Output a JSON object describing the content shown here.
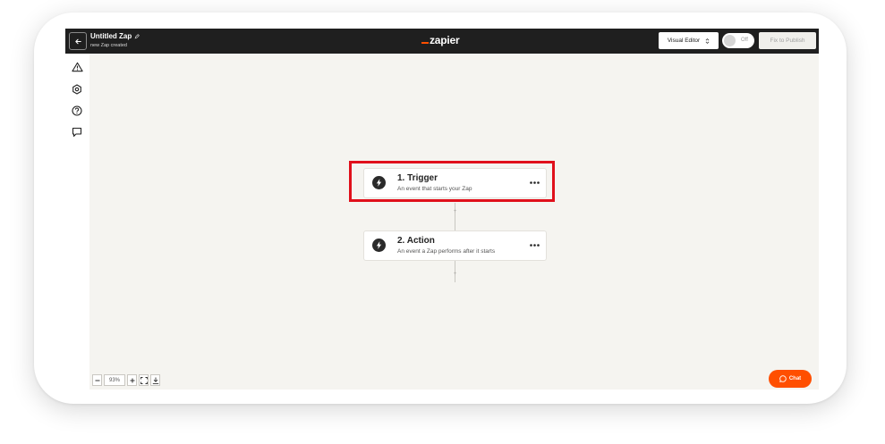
{
  "header": {
    "zap_title": "Untitled Zap",
    "zap_subtitle": "new Zap created",
    "logo_text": "zapier",
    "editor_select": "Visual Editor",
    "toggle_label": "Off",
    "publish_button": "Fix to Publish"
  },
  "sidebar": {
    "items": [
      {
        "icon": "warning-icon"
      },
      {
        "icon": "settings-icon"
      },
      {
        "icon": "help-icon"
      },
      {
        "icon": "comment-icon"
      }
    ]
  },
  "steps": [
    {
      "title": "1. Trigger",
      "description": "An event that starts your Zap",
      "icon": "lightning-icon",
      "highlighted": true
    },
    {
      "title": "2. Action",
      "description": "An event a Zap performs after it starts",
      "icon": "lightning-icon",
      "highlighted": false
    }
  ],
  "zoom": {
    "level": "93%"
  },
  "chat": {
    "label": "Chat"
  },
  "colors": {
    "brand": "#ff4f00",
    "highlight": "#e0101b",
    "topbar": "#1f1f1f",
    "canvas": "#f5f4f0"
  }
}
